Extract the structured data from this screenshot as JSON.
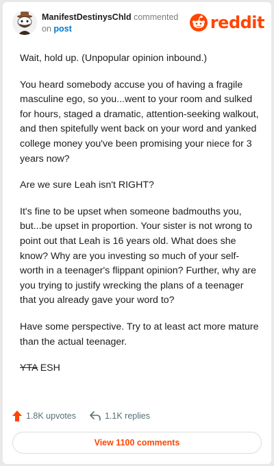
{
  "header": {
    "username": "ManifestDestinysChld",
    "commented_text": "commented",
    "on_text": "on",
    "post_link": "post",
    "logo_text": "reddit",
    "avatar_icon": "snoo-avatar-icon",
    "logo_icon": "reddit-snoo-icon"
  },
  "comment": {
    "paragraphs": [
      "Wait, hold up. (Unpopular opinion inbound.)",
      "You heard somebody accuse you of having a fragile masculine ego, so you...went to your room and sulked for hours, staged a dramatic, attention-seeking walkout, and then spitefully went back on your word and yanked college money you've been promising your niece for 3 years now?",
      "Are we sure Leah isn't RIGHT?",
      "It's fine to be upset when someone badmouths you, but...be upset in proportion. Your sister is not wrong to point out that Leah is 16 years old. What does she know? Why are you investing so much of your self-worth in a teenager's flippant opinion? Further, why are you trying to justify wrecking the plans of a teenager that you already gave your word to?",
      "Have some perspective. Try to at least act more mature than the actual teenager."
    ],
    "verdict_struck": "YTA",
    "verdict": "ESH"
  },
  "footer": {
    "upvotes": "1.8K upvotes",
    "replies": "1.1K replies",
    "view_comments": "View 1100 comments",
    "upvote_icon": "upvote-arrow-icon",
    "reply_icon": "reply-arrow-icon",
    "accent_color": "#ff4500"
  }
}
